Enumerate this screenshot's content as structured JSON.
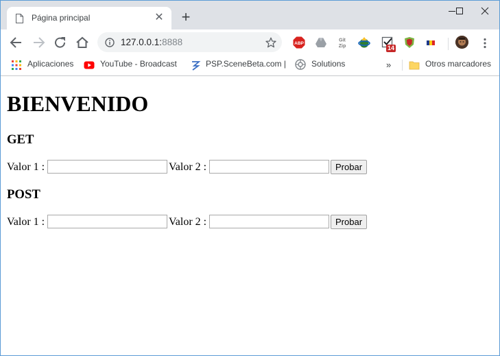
{
  "browser": {
    "tab": {
      "title": "Página principal"
    },
    "address": {
      "host": "127.0.0.1:",
      "port": "8888"
    },
    "extensions": {
      "abp": "ABP",
      "gitzip_top": "Git",
      "gitzip_bottom": "Zip",
      "badge_count": "14"
    },
    "bookmarks": [
      {
        "label": "Aplicaciones"
      },
      {
        "label": "YouTube - Broadcast"
      },
      {
        "label": "PSP.SceneBeta.com |"
      },
      {
        "label": "Solutions"
      }
    ],
    "overflow_label": "»",
    "other_bookmarks": "Otros marcadores"
  },
  "page": {
    "heading": "BIENVENIDO",
    "forms": [
      {
        "title": "GET",
        "label1": "Valor 1 :",
        "label2": "Valor 2 :",
        "value1": "",
        "value2": "",
        "submit": "Probar"
      },
      {
        "title": "POST",
        "label1": "Valor 1 :",
        "label2": "Valor 2 :",
        "value1": "",
        "value2": "",
        "submit": "Probar"
      }
    ]
  },
  "colors": {
    "tabstrip": "#dee1e6",
    "omnibox": "#f1f3f4",
    "window_border": "#5b9bd5"
  }
}
